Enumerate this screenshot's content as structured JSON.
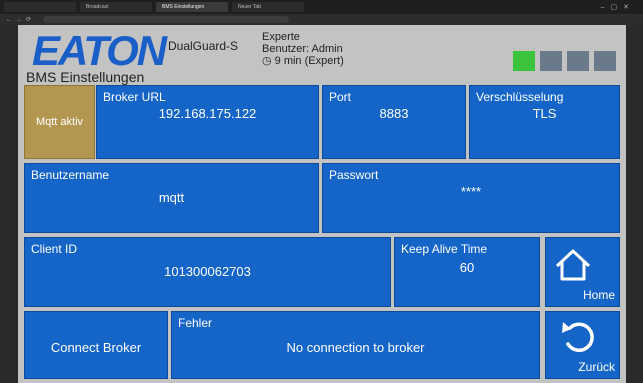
{
  "browser": {
    "tabs": [
      "",
      "Broadcast",
      "BMS Einstellungen",
      "Neuer Tab"
    ]
  },
  "header": {
    "logo": "EATON",
    "page_title": "BMS Einstellungen",
    "device_name": "DualGuard-S",
    "mode": "Experte",
    "user": "Benutzer: Admin",
    "session": "9 min (Expert)",
    "indicator_colors": [
      "#3cc43c",
      "#6a7a8a",
      "#6a7a8a",
      "#6a7a8a"
    ]
  },
  "mqtt": {
    "status_label": "Mqtt aktiv",
    "broker_url": {
      "label": "Broker URL",
      "value": "192.168.175.122"
    },
    "port": {
      "label": "Port",
      "value": "8883"
    },
    "encryption": {
      "label": "Verschlüsselung",
      "value": "TLS"
    },
    "username": {
      "label": "Benutzername",
      "value": "mqtt"
    },
    "password": {
      "label": "Passwort",
      "value": "****"
    },
    "client_id": {
      "label": "Client ID",
      "value": "101300062703"
    },
    "keep_alive": {
      "label": "Keep Alive Time",
      "value": "60"
    },
    "connect_button": "Connect Broker",
    "error": {
      "label": "Fehler",
      "value": "No connection to broker"
    }
  },
  "nav": {
    "home": "Home",
    "back": "Zurück"
  }
}
